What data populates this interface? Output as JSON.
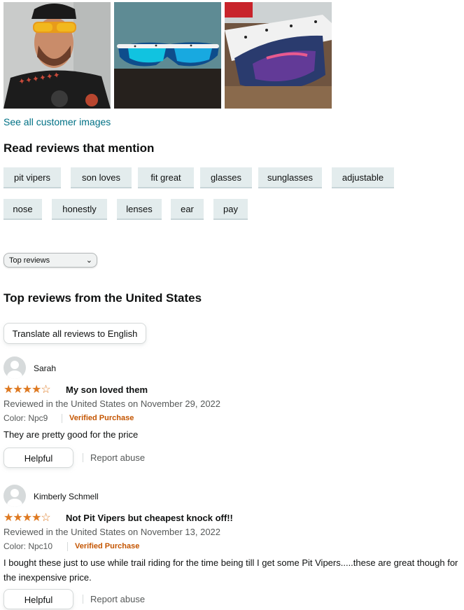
{
  "images_link": "See all customer images",
  "mentions": {
    "heading": "Read reviews that mention",
    "row1": [
      "pit vipers",
      "son loves",
      "fit great",
      "glasses",
      "sunglasses",
      "adjustable"
    ],
    "row2": [
      "nose",
      "honestly",
      "lenses",
      "ear",
      "pay"
    ]
  },
  "sort": {
    "selected": "Top reviews"
  },
  "top_heading": "Top reviews from the United States",
  "translate_label": "Translate all reviews to English",
  "reviews": [
    {
      "name": "Sarah",
      "rating": 4,
      "title": "My son loved them",
      "meta": "Reviewed in the United States on November 29, 2022",
      "color": "Color: Npc9",
      "verified": "Verified Purchase",
      "body": "They are pretty good for the price",
      "helpful": "Helpful",
      "report": "Report abuse"
    },
    {
      "name": "Kimberly Schmell",
      "rating": 4,
      "title": "Not Pit Vipers but cheapest knock off!!",
      "meta": "Reviewed in the United States on November 13, 2022",
      "color": "Color: Npc10",
      "verified": "Verified Purchase",
      "body": "I bought these just to use while trail riding for the time being till I get some Pit Vipers.....these are great though for the inexpensive price.",
      "helpful": "Helpful",
      "report": "Report abuse"
    }
  ],
  "colors": {
    "link": "#007185",
    "star": "#de7921",
    "verified": "#c45500",
    "chip_bg": "#e3eced"
  }
}
